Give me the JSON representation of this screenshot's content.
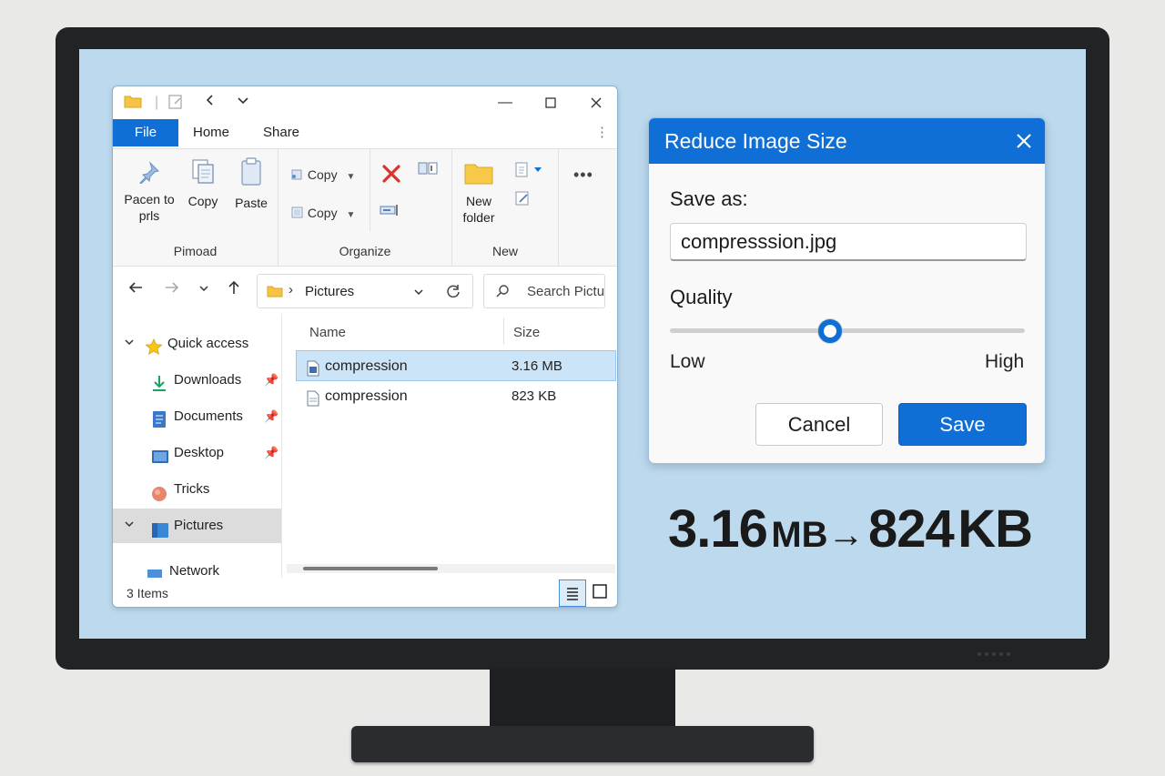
{
  "explorer": {
    "ribbon_tabs": [
      "File",
      "Home",
      "Share"
    ],
    "ribbon": {
      "clipboard": {
        "pin_label_line1": "Pacen to",
        "pin_label_line2": "prls",
        "copy_label": "Copy",
        "paste_label": "Paste",
        "group_label": "Pimoad"
      },
      "organize": {
        "copy_to_label": "Copy",
        "copy_to2_label": "Copy",
        "group_label": "Organize"
      },
      "new": {
        "new_folder_line1": "New",
        "new_folder_line2": "folder",
        "group_label": "New"
      },
      "more_label": "•••"
    },
    "address": {
      "folder": "Pictures"
    },
    "search": {
      "placeholder": "Search Pictu"
    },
    "nav": [
      {
        "label": "Quick access",
        "icon": "star-icon"
      },
      {
        "label": "Downloads",
        "icon": "download-icon"
      },
      {
        "label": "Documents",
        "icon": "documents-icon"
      },
      {
        "label": "Desktop",
        "icon": "desktop-icon"
      },
      {
        "label": "Tricks",
        "icon": "circle-icon"
      },
      {
        "label": "Pictures",
        "icon": "pictures-icon"
      },
      {
        "label": "Network",
        "icon": "network-icon"
      }
    ],
    "columns": {
      "name": "Name",
      "size": "Size"
    },
    "files": [
      {
        "name": "compression",
        "size": "3.16 MB"
      },
      {
        "name": "compression",
        "size": "823 KB"
      }
    ],
    "status": "3 Items"
  },
  "dialog": {
    "title": "Reduce Image Size",
    "save_as_label": "Save as:",
    "filename": "compresssion.jpg",
    "quality_label": "Quality",
    "quality_value": 0.45,
    "low_label": "Low",
    "high_label": "High",
    "cancel_label": "Cancel",
    "save_label": "Save"
  },
  "comparison": {
    "from_value": "3.16",
    "from_unit": "MB",
    "arrow": "→",
    "to_value": "824",
    "to_unit": "KB"
  },
  "colors": {
    "accent": "#0f6fd6",
    "screen_bg": "#bcd9ee",
    "selection": "#cce4f7"
  }
}
